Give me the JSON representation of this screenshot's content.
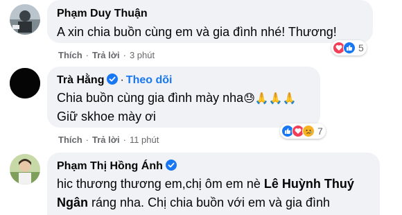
{
  "comments": [
    {
      "name": "Phạm Duy Thuận",
      "text_lines": [
        "A xin chia buồn cùng em và gia đình nhé! Thương!"
      ],
      "actions": {
        "like": "Thích",
        "reply": "Trả lời",
        "time": "3 phút"
      },
      "reactions": {
        "icons": [
          "love-icon",
          "like-icon"
        ],
        "count": "5"
      }
    },
    {
      "name": "Trà Hằng",
      "follow": "Theo dõi",
      "text_lines": [
        "Chia buồn cùng gia đình mày nha",
        "Giữ skhoe mày ơi"
      ],
      "emojis": "😓🙏🙏🙏",
      "actions": {
        "like": "Thích",
        "reply": "Trả lời",
        "time": "11 phút"
      },
      "reactions": {
        "icons": [
          "like-icon",
          "love-icon",
          "sad-icon"
        ],
        "count": "7"
      }
    },
    {
      "name": "Phạm Thị Hồng Ánh",
      "text_line1_start": "hic thương thương em,chị ôm em nè ",
      "mention_part1": "Lê Huỳnh Thuý",
      "mention_part2": "Ngân",
      "text_line2_rest": " ráng nha. Chị chia buồn với em và gia đình"
    }
  ],
  "colors": {
    "bubble": "#f0f2f5",
    "link_blue": "#1877f2",
    "meta_gray": "#65676b",
    "love_red": "#f33e58",
    "sad_yellow": "#f7b125"
  }
}
